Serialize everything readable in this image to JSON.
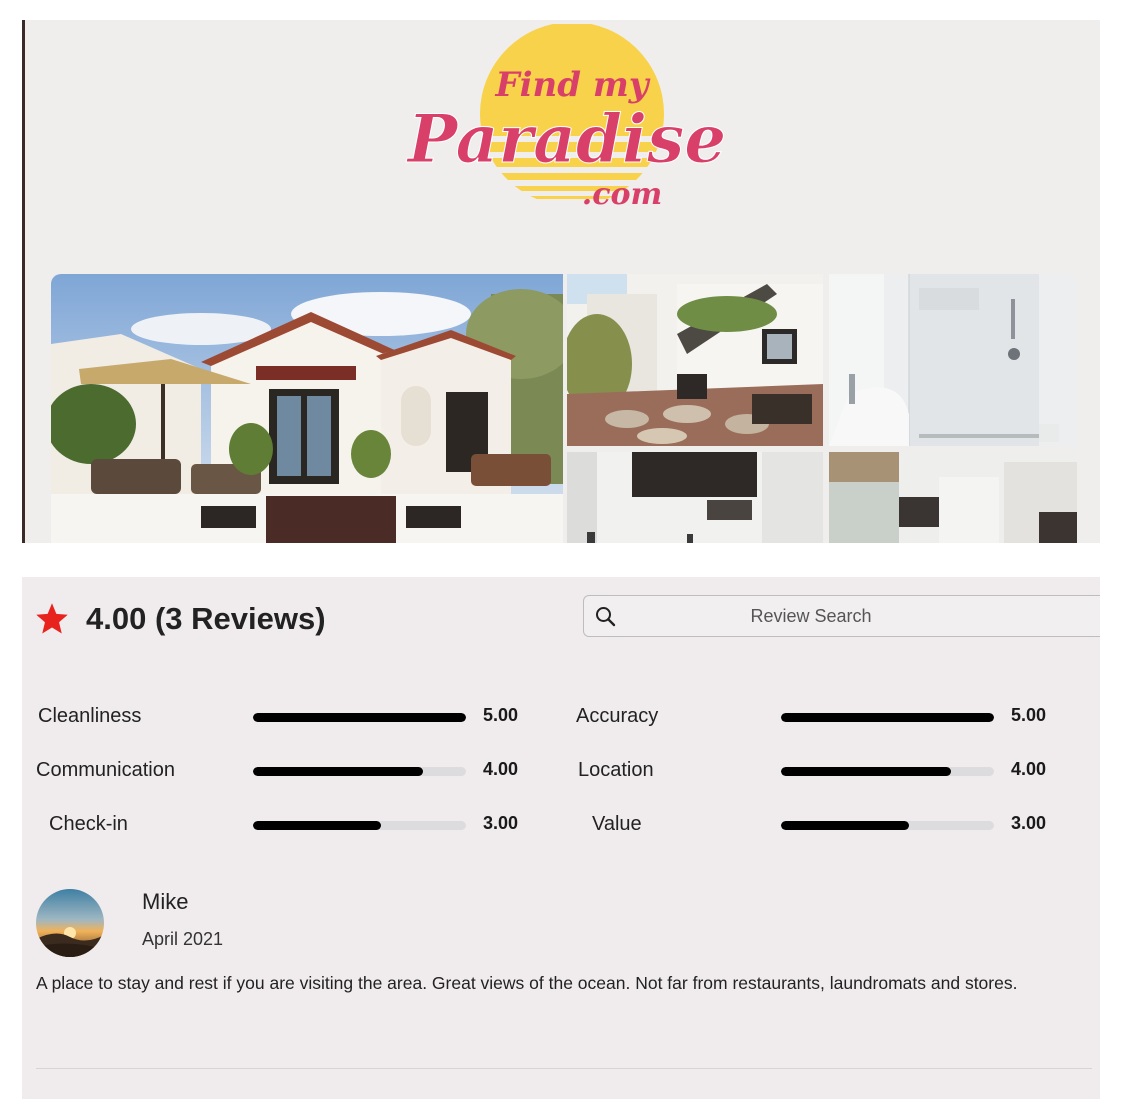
{
  "brand": {
    "logo_line1": "Find my",
    "logo_line2": "Paradise",
    "logo_line3": ".com",
    "colors": {
      "sun": "#f7d24a",
      "script": "#d8406a"
    }
  },
  "gallery": {
    "photos": [
      {
        "name": "house-front-photo"
      },
      {
        "name": "courtyard-photo"
      },
      {
        "name": "bathroom-photo"
      },
      {
        "name": "kitchen-photo"
      },
      {
        "name": "living-room-photo"
      }
    ]
  },
  "reviews_summary": {
    "star_icon": "star-icon",
    "star_color": "#e8231e",
    "text": "4.00 (3 Reviews)"
  },
  "search": {
    "icon": "search-icon",
    "placeholder": "Review Search",
    "value": ""
  },
  "ratings": [
    {
      "label": "Cleanliness",
      "value": "5.00",
      "fraction": 1.0
    },
    {
      "label": "Communication",
      "value": "4.00",
      "fraction": 0.8
    },
    {
      "label": "Check-in",
      "value": "3.00",
      "fraction": 0.6
    },
    {
      "label": "Accuracy",
      "value": "5.00",
      "fraction": 1.0
    },
    {
      "label": "Location",
      "value": "4.00",
      "fraction": 0.8
    },
    {
      "label": "Value",
      "value": "3.00",
      "fraction": 0.6
    }
  ],
  "review": {
    "avatar": "sunset-avatar",
    "name": "Mike",
    "date": "April 2021",
    "text": "A place to stay and rest if you are visiting the area. Great views of the ocean. Not far from restaurants, laundromats and stores."
  }
}
